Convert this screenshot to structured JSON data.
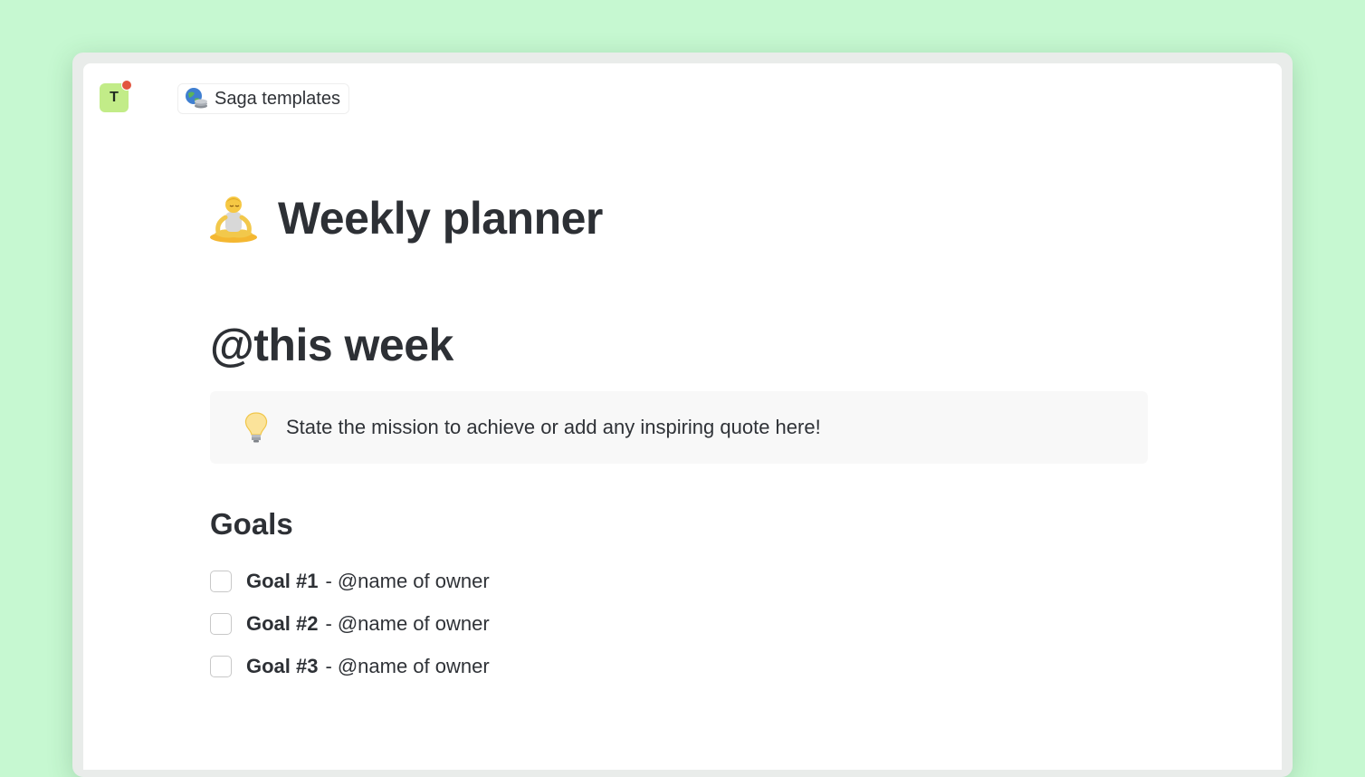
{
  "topbar": {
    "avatar_initial": "T",
    "workspace_name": "Saga templates",
    "workspace_icon": "globe-with-stack-icon"
  },
  "page": {
    "title_icon": "person-in-lotus-position-emoji",
    "title": "Weekly planner",
    "heading": "@this week",
    "callout": {
      "icon": "light-bulb-emoji",
      "text": "State the mission to achieve or add any inspiring quote here!"
    },
    "goals_heading": "Goals",
    "goals": [
      {
        "title": "Goal #1",
        "separator": "-",
        "owner": "@name of owner",
        "checked": false
      },
      {
        "title": "Goal #2",
        "separator": "-",
        "owner": "@name of owner",
        "checked": false
      },
      {
        "title": "Goal #3",
        "separator": "-",
        "owner": "@name of owner",
        "checked": false
      }
    ]
  },
  "colors": {
    "background": "#c6f8d1",
    "avatar": "#c2ec88",
    "notification": "#e2553f",
    "text": "#2d3035"
  }
}
